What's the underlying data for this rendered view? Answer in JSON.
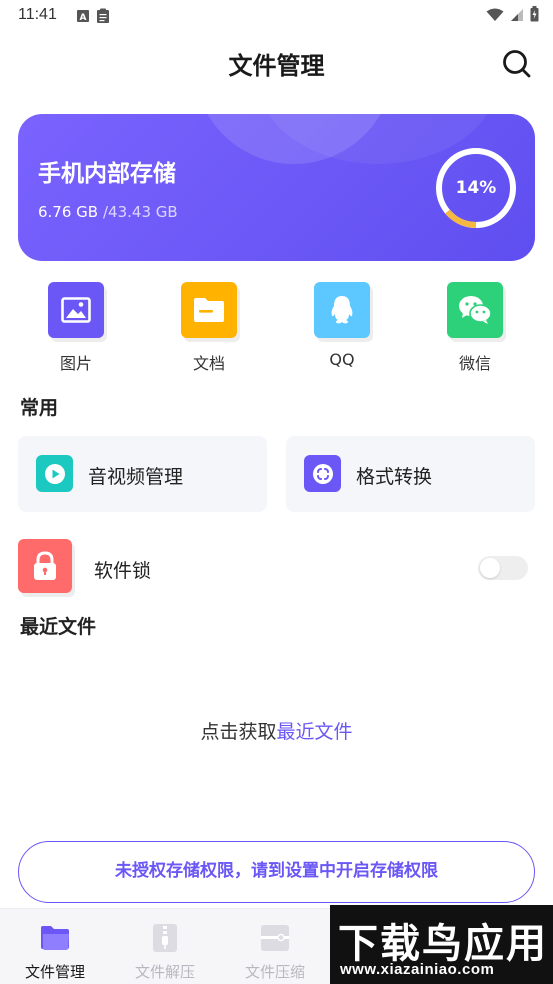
{
  "status_bar": {
    "time": "11:41"
  },
  "header": {
    "title": "文件管理"
  },
  "storage": {
    "title": "手机内部存储",
    "used": "6.76 GB",
    "total": "/43.43 GB",
    "percent_label": "14%",
    "percent": 14
  },
  "categories": [
    {
      "label": "图片",
      "icon": "image-icon",
      "color": "#6a57f5"
    },
    {
      "label": "文档",
      "icon": "folder-icon",
      "color": "#ffb300"
    },
    {
      "label": "QQ",
      "icon": "qq-icon",
      "color": "#5cc8ff"
    },
    {
      "label": "微信",
      "icon": "wechat-icon",
      "color": "#2dd17a"
    }
  ],
  "sections": {
    "common": "常用",
    "recent": "最近文件"
  },
  "favorites": [
    {
      "label": "音视频管理",
      "icon": "play-icon",
      "color": "#1cc9c0"
    },
    {
      "label": "格式转换",
      "icon": "convert-icon",
      "color": "#6a57f5"
    }
  ],
  "app_lock": {
    "label": "软件锁",
    "enabled": false,
    "color": "#ff6b6b"
  },
  "recent_empty": {
    "prefix": "点击获取",
    "link": "最近文件"
  },
  "permission_button": "未授权存储权限，请到设置中开启存储权限",
  "tabs": [
    {
      "label": "文件管理",
      "icon": "folder-tab-icon",
      "active": true
    },
    {
      "label": "文件解压",
      "icon": "zip-icon",
      "active": false
    },
    {
      "label": "文件压缩",
      "icon": "compress-icon",
      "active": false
    }
  ],
  "watermark": {
    "big": "下载鸟应用",
    "small": "www.xiazainiao.com"
  },
  "colors": {
    "accent": "#6a57f5",
    "ring_progress": "#f5b942"
  }
}
